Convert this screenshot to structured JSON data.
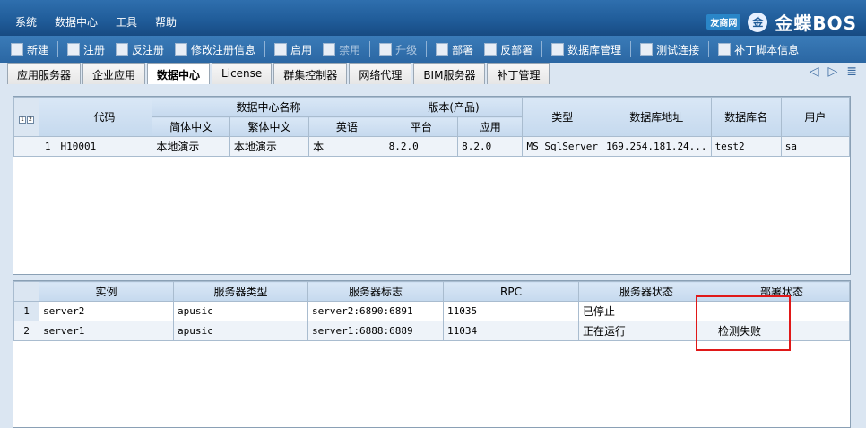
{
  "menu": [
    "系统",
    "数据中心",
    "工具",
    "帮助"
  ],
  "brand": {
    "kd": "友商网",
    "name": "金蝶BOS",
    "mark": "金"
  },
  "toolbar": [
    {
      "label": "新建",
      "icon": "new-icon",
      "enabled": true
    },
    {
      "label": "注册",
      "icon": "register-icon",
      "enabled": true
    },
    {
      "label": "反注册",
      "icon": "unregister-icon",
      "enabled": true
    },
    {
      "label": "修改注册信息",
      "icon": "edit-icon",
      "enabled": true
    },
    {
      "label": "启用",
      "icon": "enable-icon",
      "enabled": true
    },
    {
      "label": "禁用",
      "icon": "disable-icon",
      "enabled": false
    },
    {
      "label": "升级",
      "icon": "upgrade-icon",
      "enabled": false
    },
    {
      "label": "部署",
      "icon": "deploy-icon",
      "enabled": true
    },
    {
      "label": "反部署",
      "icon": "undeploy-icon",
      "enabled": true
    },
    {
      "label": "数据库管理",
      "icon": "database-icon",
      "enabled": true
    },
    {
      "label": "测试连接",
      "icon": "test-connection-icon",
      "enabled": true
    },
    {
      "label": "补丁脚本信息",
      "icon": "patch-icon",
      "enabled": true
    }
  ],
  "tabs": [
    "应用服务器",
    "企业应用",
    "数据中心",
    "License",
    "群集控制器",
    "网络代理",
    "BIM服务器",
    "补丁管理"
  ],
  "active_tab": "数据中心",
  "top_table": {
    "headers_row1": {
      "code": "代码",
      "name_group": "数据中心名称",
      "version_group": "版本(产品)",
      "type": "类型",
      "db_address": "数据库地址",
      "db_name": "数据库名",
      "user": "用户"
    },
    "headers_row2": {
      "simplified": "简体中文",
      "traditional": "繁体中文",
      "english": "英语",
      "platform": "平台",
      "application": "应用"
    },
    "rows": [
      {
        "num": "1",
        "code": "H10001",
        "simplified": "本地演示",
        "traditional": "本地演示",
        "english": "本",
        "platform": "8.2.0",
        "application": "8.2.0",
        "type": "MS SqlServer",
        "db_address": "169.254.181.24...",
        "db_name": "test2",
        "user": "sa"
      }
    ]
  },
  "bottom_table": {
    "headers": [
      "实例",
      "服务器类型",
      "服务器标志",
      "RPC",
      "服务器状态",
      "部署状态"
    ],
    "rows": [
      {
        "num": "1",
        "instance": "server2",
        "type": "apusic",
        "flag": "server2:6890:6891",
        "rpc": "11035",
        "status": "已停止",
        "deploy": ""
      },
      {
        "num": "2",
        "instance": "server1",
        "type": "apusic",
        "flag": "server1:6888:6889",
        "rpc": "11034",
        "status": "正在运行",
        "deploy": "检测失败"
      }
    ]
  },
  "highlight_color": "#e01818"
}
